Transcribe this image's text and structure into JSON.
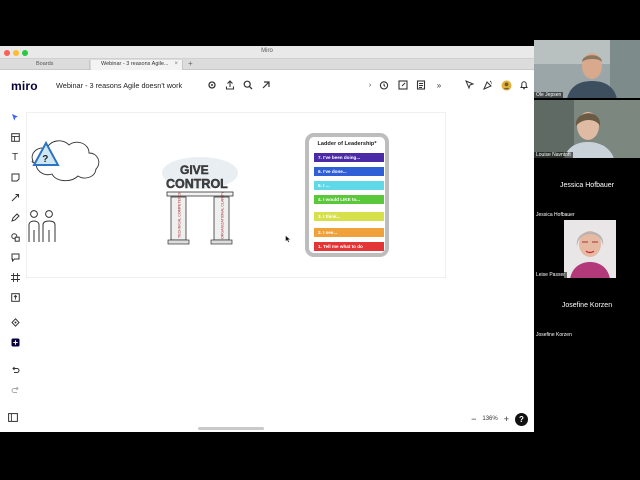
{
  "window": {
    "title": "Miro",
    "tabs": [
      {
        "label": "Boards"
      },
      {
        "label": "Webinar - 3 reasons Agile..."
      }
    ]
  },
  "app": {
    "logo": "miro",
    "board_title": "Webinar - 3 reasons Agile doesn't work"
  },
  "colors": {
    "accent": "#4262ff",
    "traffic_red": "#fe5f57",
    "traffic_yellow": "#febc2e",
    "traffic_green": "#28c840"
  },
  "canvas": {
    "sketch_left_label": "?",
    "give_control": {
      "line1": "GIVE",
      "line2": "CONTROL",
      "pillar_left": "TECHNICAL COMPETENCE",
      "pillar_right": "ORGANIZATIONAL CLARITY"
    },
    "ladder": {
      "title": "Ladder of Leadership*",
      "rungs": [
        {
          "label": "7. I've been doing...",
          "color": "#4b2aa8"
        },
        {
          "label": "6. I've done...",
          "color": "#2f5fd6"
        },
        {
          "label": "5. I ...",
          "color": "#5fd9e8"
        },
        {
          "label": "4. I would LIKE to...",
          "color": "#5ac83a"
        },
        {
          "label": "3. I think...",
          "color": "#d6e04a"
        },
        {
          "label": "2. I see...",
          "color": "#f0a13a"
        },
        {
          "label": "1. Tell me what to do",
          "color": "#e33535"
        }
      ]
    }
  },
  "zoom": {
    "level": "136%"
  },
  "participants": [
    {
      "name": "Ole Jepsen",
      "video": true
    },
    {
      "name": "Louise Navntoft",
      "video": true
    },
    {
      "name": "Jessica Hofbauer",
      "video": false
    },
    {
      "name": "Leise Passer",
      "video": true
    },
    {
      "name": "Josefine Korzen",
      "video": false
    }
  ]
}
